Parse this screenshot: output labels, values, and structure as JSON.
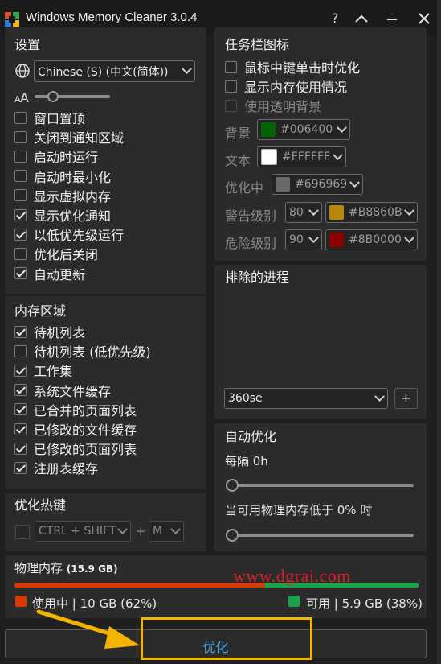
{
  "window": {
    "title": "Windows Memory Cleaner 3.0.4",
    "help": "?",
    "collapse_icon": "chevron-up-icon",
    "minimize_icon": "minimize-icon",
    "close_icon": "close-icon"
  },
  "settings": {
    "title": "设置",
    "language": "Chinese (S) (中文(简体))",
    "font_size_fraction": 0.2,
    "items": [
      {
        "label": "窗口置顶",
        "checked": false
      },
      {
        "label": "关闭到通知区域",
        "checked": false
      },
      {
        "label": "启动时运行",
        "checked": false
      },
      {
        "label": "启动时最小化",
        "checked": false
      },
      {
        "label": "显示虚拟内存",
        "checked": false
      },
      {
        "label": "显示优化通知",
        "checked": true
      },
      {
        "label": "以低优先级运行",
        "checked": true
      },
      {
        "label": "优化后关闭",
        "checked": false
      },
      {
        "label": "自动更新",
        "checked": true
      }
    ]
  },
  "memory_areas": {
    "title": "内存区域",
    "items": [
      {
        "label": "待机列表",
        "checked": true
      },
      {
        "label": "待机列表 (低优先级)",
        "checked": false
      },
      {
        "label": "工作集",
        "checked": true
      },
      {
        "label": "系统文件缓存",
        "checked": true
      },
      {
        "label": "已合并的页面列表",
        "checked": true
      },
      {
        "label": "已修改的文件缓存",
        "checked": true
      },
      {
        "label": "已修改的页面列表",
        "checked": true
      },
      {
        "label": "注册表缓存",
        "checked": true
      }
    ]
  },
  "hotkey": {
    "title": "优化热键",
    "modifier": "CTRL + SHIFT",
    "plus": "+",
    "key": "M"
  },
  "tray": {
    "title": "任务栏图标",
    "items": [
      {
        "label": "鼠标中键单击时优化",
        "checked": false
      },
      {
        "label": "显示内存使用情况",
        "checked": false
      },
      {
        "label": "使用透明背景",
        "checked": false
      }
    ],
    "background_label": "背景",
    "background_color": "#006400",
    "text_label": "文本",
    "text_color": "#FFFFFF",
    "optimizing_label": "优化中",
    "optimizing_color": "#696969",
    "warning_label": "警告级别",
    "warning_level": "80",
    "warning_color": "#B8860B",
    "danger_label": "危险级别",
    "danger_level": "90",
    "danger_color": "#8B0000"
  },
  "exclusions": {
    "title": "排除的进程",
    "process": "360se",
    "add_label": "+"
  },
  "auto_optimize": {
    "title": "自动优化",
    "interval_label": "每隔 0h",
    "interval_fraction": 0,
    "threshold_label": "当可用物理内存低于 0% 时",
    "threshold_fraction": 0
  },
  "physical_memory": {
    "title": "物理内存",
    "total": "(15.9 GB)",
    "used_fraction": 0.62,
    "used_color": "#d83b01",
    "free_color": "#16a34a",
    "used_text": "使用中 | 10 GB (62%)",
    "free_text": "可用 | 5.9 GB (38%)"
  },
  "optimize_button": "优化",
  "watermark": "www.dgrai.com",
  "annotation_color": "#f5b400"
}
